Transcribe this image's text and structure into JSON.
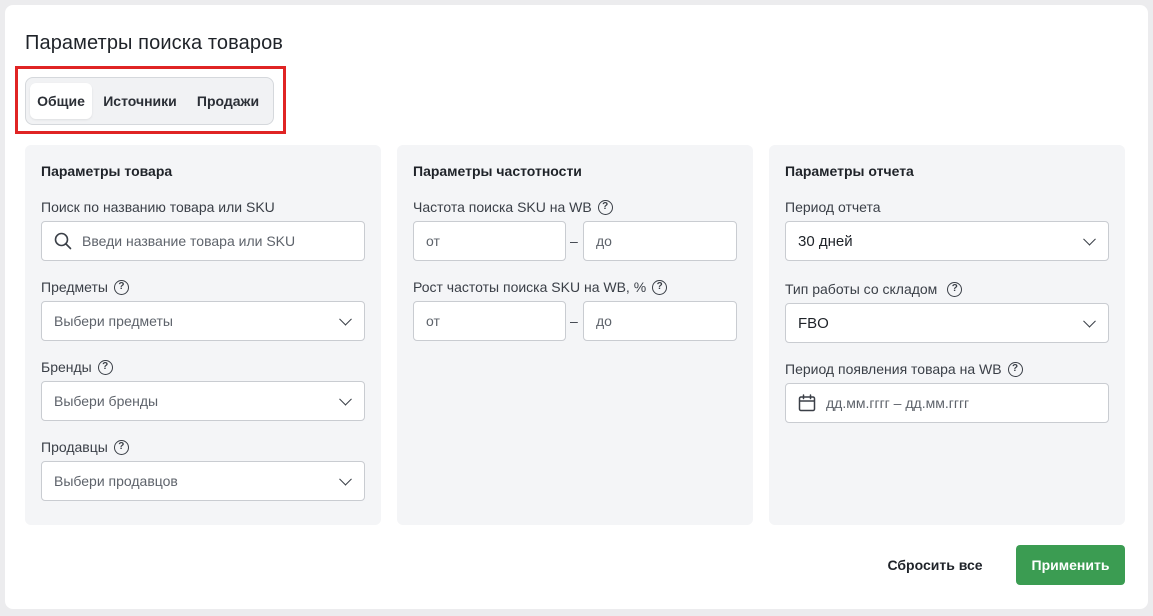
{
  "page_title": "Параметры поиска товаров",
  "tabs": [
    {
      "label": "Общие",
      "active": true
    },
    {
      "label": "Источники",
      "active": false
    },
    {
      "label": "Продажи",
      "active": false
    }
  ],
  "product_params": {
    "title": "Параметры товара",
    "search_label": "Поиск по названию товара или SKU",
    "search_placeholder": "Введи название товара или SKU",
    "subjects_label": "Предметы",
    "subjects_placeholder": "Выбери предметы",
    "brands_label": "Бренды",
    "brands_placeholder": "Выбери бренды",
    "sellers_label": "Продавцы",
    "sellers_placeholder": "Выбери продавцов"
  },
  "frequency_params": {
    "title": "Параметры частотности",
    "freq_label": "Частота поиска SKU на WB",
    "freq_from": "от",
    "freq_to": "до",
    "growth_label": "Рост частоты поиска SKU на WB, %",
    "growth_from": "от",
    "growth_to": "до",
    "range_dash": "–"
  },
  "report_params": {
    "title": "Параметры отчета",
    "period_label": "Период отчета",
    "period_value": "30 дней",
    "warehouse_label": "Тип работы со складом",
    "warehouse_value": "FBO",
    "appearance_label": "Период появления товара на WB",
    "appearance_placeholder": "дд.мм.гггг – дд.мм.гггг"
  },
  "actions": {
    "reset_label": "Сбросить все",
    "apply_label": "Применить"
  },
  "colors": {
    "apply_button": "#3b9c52",
    "highlight_border": "#e02424",
    "panel_bg": "#f4f5f7"
  },
  "help_glyph": "?"
}
